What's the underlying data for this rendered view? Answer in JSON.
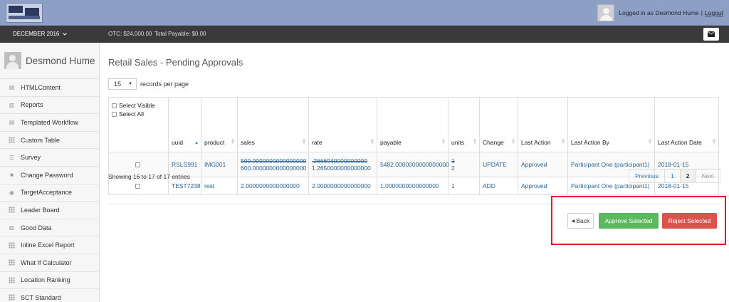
{
  "header": {
    "logged_in_text": "Logged in as Desmond Hume",
    "separator": "|",
    "logout": "Logout"
  },
  "subbar": {
    "period": "DECEMBER 2016",
    "otc": "OTC: $24,000.00",
    "total_payable": "Total Payable: $0.00"
  },
  "sidebar": {
    "user_name": "Desmond Hume",
    "items": [
      {
        "label": "HTMLContent",
        "icon": "file-icon"
      },
      {
        "label": "Reports",
        "icon": "bar-chart-icon"
      },
      {
        "label": "Templated Workflow",
        "icon": "file-icon"
      },
      {
        "label": "Custom Table",
        "icon": "grid-icon"
      },
      {
        "label": "Survey",
        "icon": "list-icon"
      },
      {
        "label": "Change Password",
        "icon": "lock-icon"
      },
      {
        "label": "TargetAcceptance",
        "icon": "target-icon"
      },
      {
        "label": "Leader Board",
        "icon": "grid-icon"
      },
      {
        "label": "Good Data",
        "icon": "bar-chart-icon"
      },
      {
        "label": "Inline Excel Report",
        "icon": "grid-icon"
      },
      {
        "label": "What If Calculator",
        "icon": "grid-icon"
      },
      {
        "label": "Location Ranking",
        "icon": "grid-icon"
      },
      {
        "label": "SCT Standard",
        "icon": "grid-icon"
      }
    ]
  },
  "main": {
    "title": "Retail Sales - Pending Approvals",
    "page_length": "15",
    "records_per_page": "records per page",
    "select_visible": "Select Visible",
    "select_all": "Select All",
    "columns": [
      "uuid",
      "product",
      "sales",
      "rate",
      "payable",
      "units",
      "Change",
      "Last Action",
      "Last Action By",
      "Last Action Date"
    ],
    "rows": [
      {
        "uuid": "RSLS991",
        "product": "IMG001",
        "sales_old": "500.0000000000000000",
        "sales_new": "600.0000000000000000",
        "rate_old": ".2666940000000000",
        "rate_new": "1.2650000000000000",
        "payable": "5482.0000000000000000",
        "units_old": "1",
        "units_new": "2",
        "change": "UPDATE",
        "last_action": "Approved",
        "last_action_by": "Participant One (participant1)",
        "last_action_date": "2018-01-15"
      },
      {
        "uuid": "TEST7238",
        "product": "rest",
        "sales": "2.0000000000000000",
        "rate": "2.0000000000000000",
        "payable": "1.0000000000000000",
        "units": "1",
        "change": "ADD",
        "last_action": "Approved",
        "last_action_by": "Participant One (participant1)",
        "last_action_date": "2018-01-15"
      }
    ],
    "info": "Showing 16 to 17 of 17 entries",
    "pager": {
      "previous": "Previous",
      "page1": "1",
      "page2": "2",
      "next": "Next"
    },
    "buttons": {
      "back": "Back",
      "approve": "Approve Selected",
      "reject": "Reject Selected"
    }
  },
  "colors": {
    "approve": "#5cb85c",
    "reject": "#d9534f",
    "highlight": "#e11a2a"
  }
}
